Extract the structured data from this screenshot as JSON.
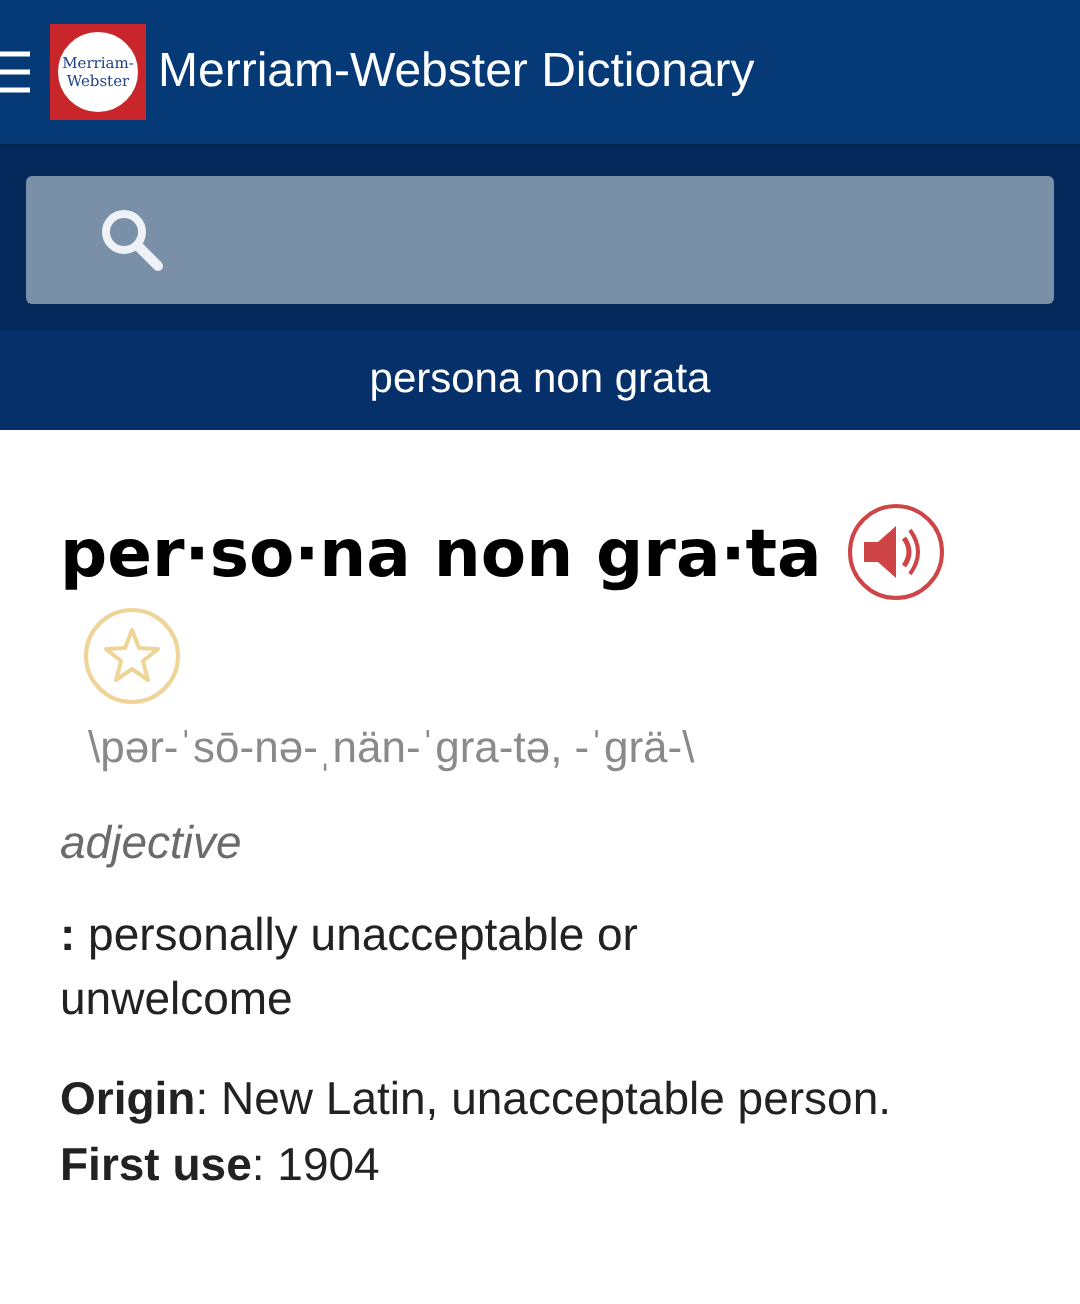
{
  "app_bar": {
    "logo_text": [
      "Merriam-",
      "Webster"
    ],
    "title": "Merriam-Webster Dictionary"
  },
  "current_word": "persona non grata",
  "entry": {
    "headword": "per·so·na non gra·ta",
    "favorited": false,
    "pronunciation": "\\pər-ˈsō-nə-ˌnän-ˈgra-tə, -ˈgrä-\\",
    "part_of_speech": "adjective",
    "definitions": [
      {
        "marker": ":",
        "text": "personally unacceptable or unwelcome"
      }
    ],
    "facts": [
      {
        "label": "Origin",
        "text": ": New Latin, unacceptable person."
      },
      {
        "label": "First use",
        "text": ": 1904"
      }
    ]
  }
}
